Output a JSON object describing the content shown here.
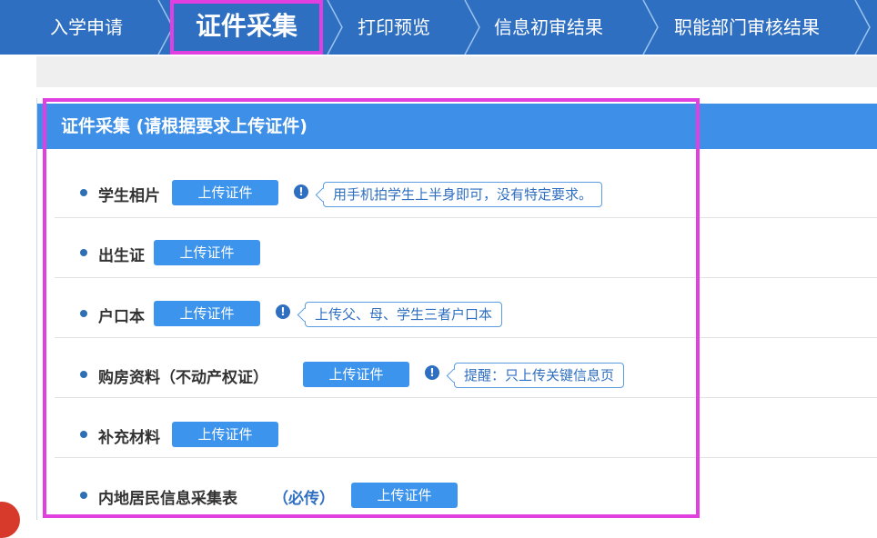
{
  "steps": [
    {
      "label": "入学申请"
    },
    {
      "label": "证件采集",
      "active": true
    },
    {
      "label": "打印预览"
    },
    {
      "label": "信息初审结果"
    },
    {
      "label": "职能部门审核结果"
    }
  ],
  "panel": {
    "title": "证件采集 (请根据要求上传证件)"
  },
  "upload_label": "上传证件",
  "items": [
    {
      "label": "学生相片",
      "tip": "用手机拍学生上半身即可，没有特定要求。"
    },
    {
      "label": "出生证"
    },
    {
      "label": "户口本",
      "tip": "上传父、母、学生三者户口本"
    },
    {
      "label": "购房资料（不动产权证）",
      "tip": "提醒：只上传关键信息页"
    },
    {
      "label": "补充材料"
    },
    {
      "label": "内地居民信息采集表",
      "required": "（必传）"
    }
  ],
  "colors": {
    "nav_bg": "#2f6fc1",
    "header_bg": "#3d8fe8",
    "button_bg": "#3d94ec",
    "highlight": "#e23fe0"
  },
  "icons": {
    "info": "exclamation-circle-icon",
    "step_separator": "chevron-right-icon"
  }
}
